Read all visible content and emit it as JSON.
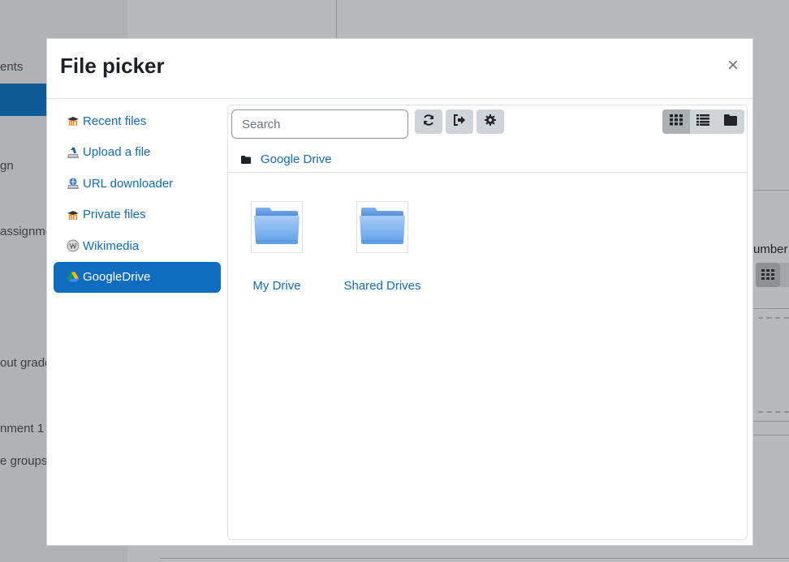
{
  "background": {
    "left_texts": [
      "ents",
      "gn",
      "assignme",
      "out grade",
      "nment 1",
      "e groups"
    ],
    "right_text": "umber"
  },
  "modal": {
    "title": "File picker",
    "close_label": "×"
  },
  "sidebar": {
    "items": [
      {
        "label": "Recent files",
        "icon": "moodle-icon",
        "active": false
      },
      {
        "label": "Upload a file",
        "icon": "upload-icon",
        "active": false
      },
      {
        "label": "URL downloader",
        "icon": "url-download-icon",
        "active": false
      },
      {
        "label": "Private files",
        "icon": "moodle-icon",
        "active": false
      },
      {
        "label": "Wikimedia",
        "icon": "wikimedia-icon",
        "active": false
      },
      {
        "label": "GoogleDrive",
        "icon": "google-drive-icon",
        "active": true
      }
    ]
  },
  "toolbar": {
    "search_placeholder": "Search",
    "buttons": [
      "refresh-icon",
      "logout-icon",
      "settings-icon"
    ],
    "view_modes": [
      "grid-view-icon",
      "list-view-icon",
      "tree-view-icon"
    ],
    "active_view": "grid"
  },
  "breadcrumb": {
    "label": "Google Drive"
  },
  "files": [
    {
      "name": "My Drive",
      "icon": "folder-icon"
    },
    {
      "name": "Shared Drives",
      "icon": "folder-icon"
    }
  ],
  "colors": {
    "link": "#0f6cbf",
    "active_bg": "#0f6cbf",
    "button_bg": "#ced4da"
  }
}
